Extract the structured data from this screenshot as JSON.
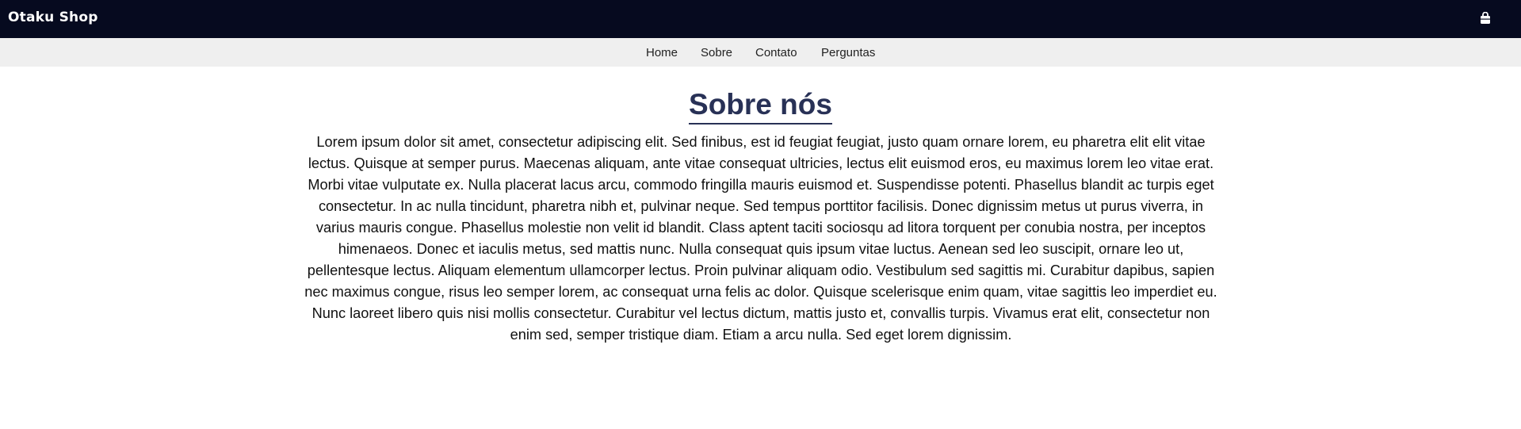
{
  "header": {
    "brand": "Otaku Shop",
    "cart_icon": "cart-icon",
    "background": "#060a1f"
  },
  "nav": {
    "items": [
      {
        "label": "Home"
      },
      {
        "label": "Sobre"
      },
      {
        "label": "Contato"
      },
      {
        "label": "Perguntas"
      }
    ],
    "background": "#efefef"
  },
  "main": {
    "title": "Sobre nós",
    "title_color": "#283156",
    "paragraph": "Lorem ipsum dolor sit amet, consectetur adipiscing elit. Sed finibus, est id feugiat feugiat, justo quam ornare lorem, eu pharetra elit elit vitae lectus. Quisque at semper purus. Maecenas aliquam, ante vitae consequat ultricies, lectus elit euismod eros, eu maximus lorem leo vitae erat. Morbi vitae vulputate ex. Nulla placerat lacus arcu, commodo fringilla mauris euismod et. Suspendisse potenti. Phasellus blandit ac turpis eget consectetur. In ac nulla tincidunt, pharetra nibh et, pulvinar neque. Sed tempus porttitor facilisis. Donec dignissim metus ut purus viverra, in varius mauris congue. Phasellus molestie non velit id blandit. Class aptent taciti sociosqu ad litora torquent per conubia nostra, per inceptos himenaeos. Donec et iaculis metus, sed mattis nunc. Nulla consequat quis ipsum vitae luctus. Aenean sed leo suscipit, ornare leo ut, pellentesque lectus. Aliquam elementum ullamcorper lectus. Proin pulvinar aliquam odio. Vestibulum sed sagittis mi. Curabitur dapibus, sapien nec maximus congue, risus leo semper lorem, ac consequat urna felis ac dolor. Quisque scelerisque enim quam, vitae sagittis leo imperdiet eu. Nunc laoreet libero quis nisi mollis consectetur. Curabitur vel lectus dictum, mattis justo et, convallis turpis. Vivamus erat elit, consectetur non enim sed, semper tristique diam. Etiam a arcu nulla. Sed eget lorem dignissim."
  }
}
